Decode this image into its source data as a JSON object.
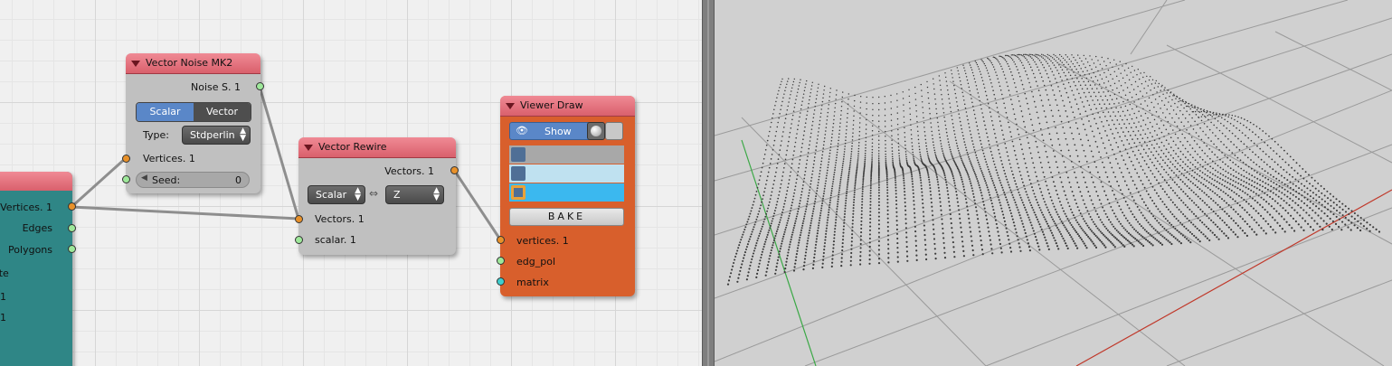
{
  "teal_node": {
    "outputs": [
      "Vertices. 1",
      "Edges",
      "Polygons"
    ],
    "partial_labels": [
      "ate",
      "1",
      "1"
    ]
  },
  "noise_node": {
    "title": "Vector Noise MK2",
    "output": "Noise S. 1",
    "mode_options": [
      "Scalar",
      "Vector"
    ],
    "mode_selected": "Scalar",
    "type_label": "Type:",
    "type_value": "Stdperlin",
    "input_vertices": "Vertices. 1",
    "seed_label": "Seed:",
    "seed_value": "0"
  },
  "rewire_node": {
    "title": "Vector Rewire",
    "output": "Vectors. 1",
    "left_select": "Scalar",
    "right_select": "Z",
    "input_vectors": "Vectors. 1",
    "input_scalar": "scalar. 1"
  },
  "viewer_node": {
    "title": "Viewer Draw",
    "show_label": "Show",
    "color_rows": [
      "#a8a8a8",
      "#bfe1f0",
      "#3bb8ef"
    ],
    "bake_label": "BAKE",
    "inputs": [
      "vertices. 1",
      "edg_pol",
      "matrix"
    ]
  },
  "colors": {
    "node_header": "#e06f7a",
    "grey_node_body": "#c0c0c0",
    "teal_node_body": "#2f8686",
    "viewer_node_body": "#d85f2c",
    "socket_orange": "#e8912a",
    "socket_green": "#9ee89a",
    "socket_cyan": "#3ecfcf",
    "accent_blue": "#5a87c8"
  }
}
